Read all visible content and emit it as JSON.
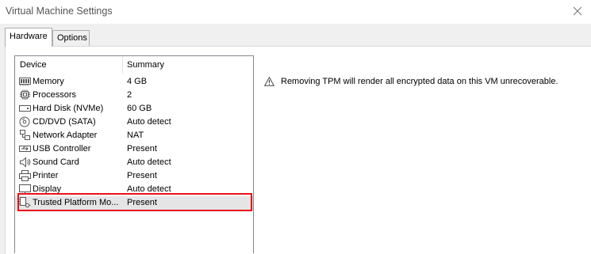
{
  "window": {
    "title": "Virtual Machine Settings"
  },
  "tabs": [
    {
      "label": "Hardware",
      "active": true
    },
    {
      "label": "Options",
      "active": false
    }
  ],
  "device_list": {
    "columns": [
      "Device",
      "Summary"
    ],
    "rows": [
      {
        "icon": "memory-icon",
        "device": "Memory",
        "summary": "4 GB"
      },
      {
        "icon": "processor-icon",
        "device": "Processors",
        "summary": "2"
      },
      {
        "icon": "hard-disk-icon",
        "device": "Hard Disk (NVMe)",
        "summary": "60 GB"
      },
      {
        "icon": "cd-dvd-icon",
        "device": "CD/DVD (SATA)",
        "summary": "Auto detect"
      },
      {
        "icon": "network-adapter-icon",
        "device": "Network Adapter",
        "summary": "NAT"
      },
      {
        "icon": "usb-icon",
        "device": "USB Controller",
        "summary": "Present"
      },
      {
        "icon": "sound-card-icon",
        "device": "Sound Card",
        "summary": "Auto detect"
      },
      {
        "icon": "printer-icon",
        "device": "Printer",
        "summary": "Present"
      },
      {
        "icon": "display-icon",
        "device": "Display",
        "summary": "Auto detect"
      },
      {
        "icon": "tpm-icon",
        "device": "Trusted Platform Mo...",
        "summary": "Present",
        "selected": true
      }
    ]
  },
  "warning": {
    "icon": "warning-icon",
    "text": "Removing TPM will render all encrypted data on this VM unrecoverable."
  },
  "colors": {
    "highlight": "#e8101a",
    "selected_row": "#e5e5e5"
  }
}
